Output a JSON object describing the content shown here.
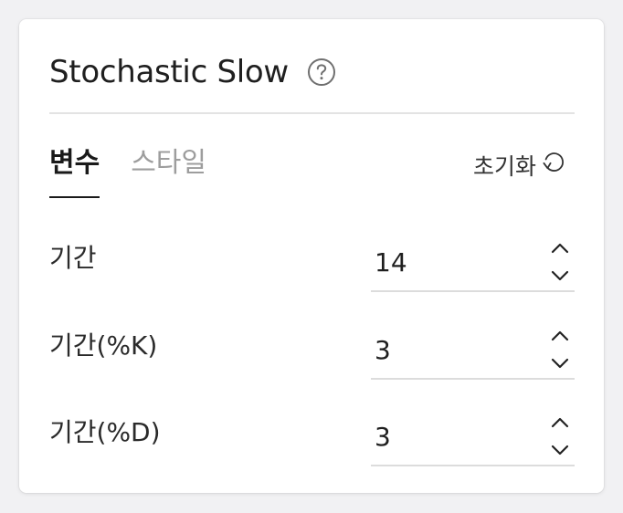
{
  "dialog": {
    "title": "Stochastic Slow",
    "help_icon": "question-circle-icon"
  },
  "tabs": [
    {
      "label": "변수",
      "active": true
    },
    {
      "label": "스타일",
      "active": false
    }
  ],
  "reset": {
    "label": "초기화",
    "icon": "refresh-icon"
  },
  "params": [
    {
      "label": "기간",
      "value": "14"
    },
    {
      "label": "기간(%K)",
      "value": "3"
    },
    {
      "label": "기간(%D)",
      "value": "3"
    }
  ],
  "colors": {
    "background": "#f1f1f3",
    "panel": "#ffffff",
    "text_primary": "#1f1f1f",
    "text_muted": "#9d9d9d",
    "divider": "#e3e3e3"
  }
}
